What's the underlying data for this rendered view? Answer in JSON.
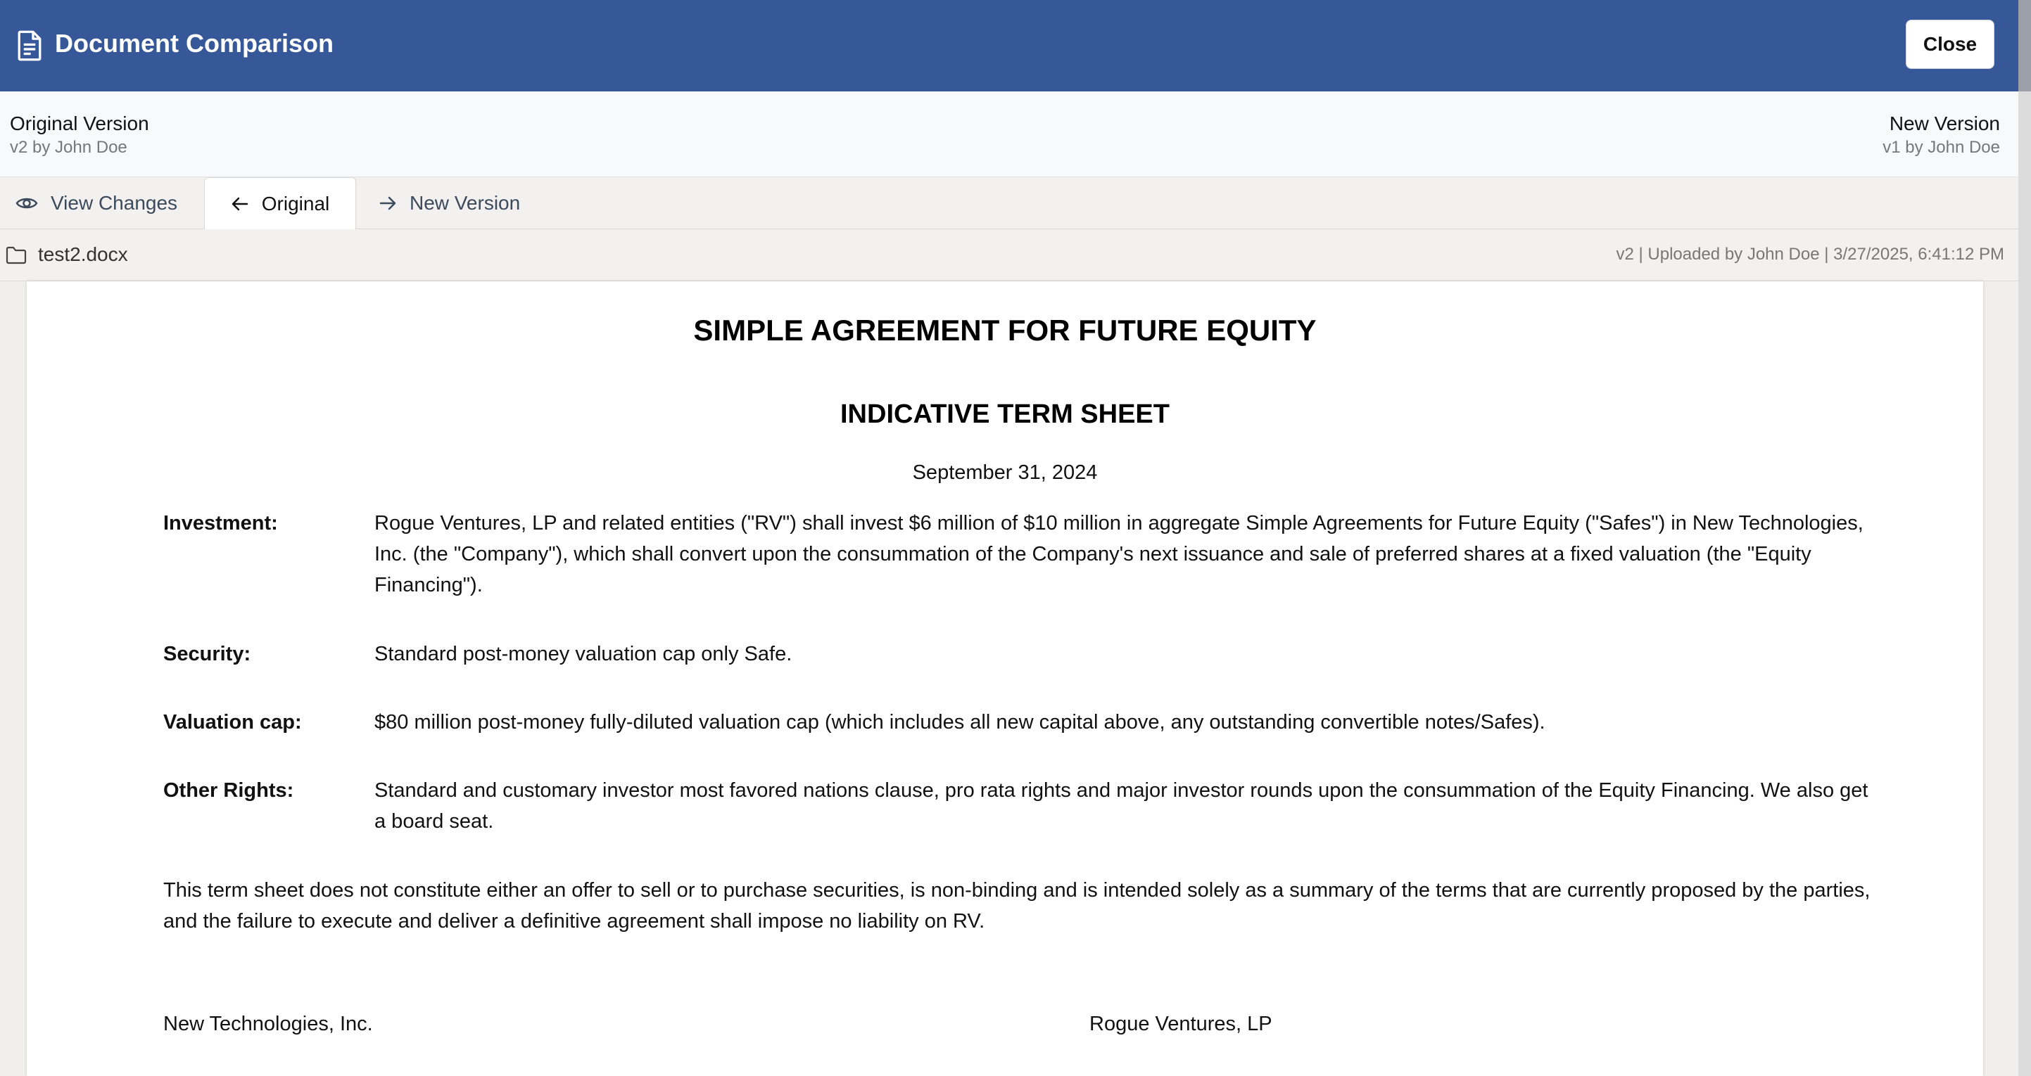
{
  "header": {
    "title": "Document Comparison",
    "close_label": "Close"
  },
  "versions": {
    "original": {
      "name": "Original Version",
      "meta": "v2 by John Doe"
    },
    "new": {
      "name": "New Version",
      "meta": "v1 by John Doe"
    }
  },
  "tabs": [
    {
      "label": "View Changes",
      "icon": "eye-icon"
    },
    {
      "label": "Original",
      "icon": "arrow-left-icon",
      "active": true
    },
    {
      "label": "New Version",
      "icon": "arrow-right-icon"
    }
  ],
  "file": {
    "name": "test2.docx",
    "meta": "v2 | Uploaded by John Doe | 3/27/2025, 6:41:12 PM"
  },
  "document": {
    "title": "SIMPLE AGREEMENT FOR FUTURE EQUITY",
    "subtitle": "INDICATIVE TERM SHEET",
    "date": "September 31, 2024",
    "terms": [
      {
        "label": "Investment:",
        "text": "Rogue Ventures, LP and related entities (\"RV\") shall invest $6 million of $10 million in aggregate Simple Agreements for Future Equity (\"Safes\") in New Technologies, Inc. (the \"Company\"), which shall convert upon the consummation of the Company's next issuance and sale of preferred shares at a fixed valuation (the \"Equity Financing\")."
      },
      {
        "label": "Security:",
        "text": "Standard post-money valuation cap only Safe."
      },
      {
        "label": "Valuation cap:",
        "text": "$80 million post-money fully-diluted valuation cap (which includes all new capital above, any outstanding convertible notes/Safes)."
      },
      {
        "label": "Other Rights:",
        "text": "Standard and customary investor most favored nations clause, pro rata rights and major investor rounds upon the consummation of the Equity Financing. We also get a board seat."
      }
    ],
    "disclaimer": "This term sheet does not constitute either an offer to sell or to purchase securities, is non-binding and is intended solely as a summary of the terms that are currently proposed by the parties, and the failure to execute and deliver a definitive agreement shall impose no liability on RV.",
    "signatory_left": "New Technologies, Inc.",
    "signatory_right": "Rogue Ventures, LP"
  }
}
